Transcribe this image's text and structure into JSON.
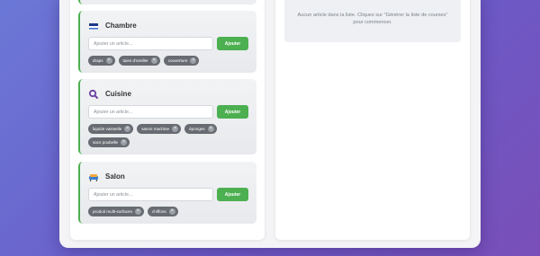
{
  "rooms": [
    {
      "name": "Chambre",
      "icon": "bed-flag-icon",
      "placeholder": "Ajouter un article...",
      "button": "Ajouter",
      "items": [
        "draps",
        "taies d'oreiller",
        "couverture"
      ]
    },
    {
      "name": "Cuisine",
      "icon": "magnifier-icon",
      "placeholder": "Ajouter un article...",
      "button": "Ajouter",
      "items": [
        "liquide vaisselle",
        "savon machine",
        "éponges",
        "sacs poubelle"
      ]
    },
    {
      "name": "Salon",
      "icon": "sofa-icon",
      "placeholder": "Ajouter un article...",
      "button": "Ajouter",
      "items": [
        "produit multi-surfaces",
        "chiffons"
      ]
    }
  ],
  "remove_glyph": "×",
  "shopping_list": {
    "empty_message": "Aucun article dans la liste. Cliquez sur \"Générer la liste de courses\" pour commencer."
  },
  "colors": {
    "accent": "#4caf50",
    "tag": "#686c72",
    "background_gradient": [
      "#6b78d6",
      "#7a4fb8"
    ]
  }
}
